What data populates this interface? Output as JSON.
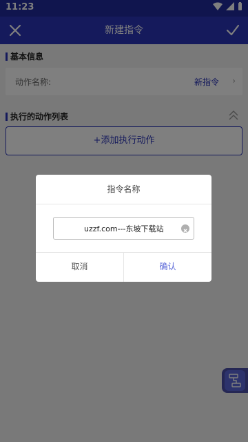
{
  "status": {
    "time": "11:23"
  },
  "appbar": {
    "title": "新建指令"
  },
  "basic": {
    "section_title": "基本信息",
    "name_label": "动作名称:",
    "name_value": "新指令",
    "arrow": "›"
  },
  "actions": {
    "section_title": "执行的动作列表",
    "add_label": "+添加执行动作"
  },
  "dialog": {
    "title": "指令名称",
    "input_value": "uzzf.com---东坡下载站",
    "cancel_label": "取消",
    "ok_label": "确认"
  },
  "colors": {
    "primary": "#2b35b8",
    "accent": "#5a67d8"
  }
}
